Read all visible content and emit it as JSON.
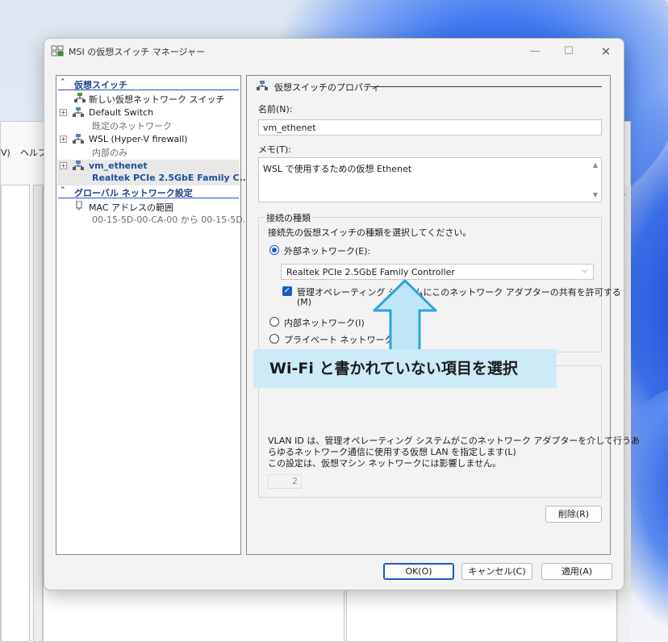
{
  "background_window": {
    "menu_items": [
      "V)",
      "ヘルプ"
    ]
  },
  "dialog": {
    "title": "MSI の仮想スイッチ マネージャー",
    "title_buttons": [
      "minimize",
      "maximize",
      "close"
    ]
  },
  "tree": {
    "section_switches": "仮想スイッチ",
    "new_switch": "新しい仮想ネットワーク スイッチ",
    "switches": [
      {
        "name": "Default Switch",
        "detail": "既定のネットワーク"
      },
      {
        "name": "WSL (Hyper-V firewall)",
        "detail": "内部のみ"
      },
      {
        "name": "vm_ethenet",
        "detail": "Realtek PCIe 2.5GbE Family C..."
      }
    ],
    "section_global": "グローバル ネットワーク設定",
    "mac_range_label": "MAC アドレスの範囲",
    "mac_range_value": "00-15-5D-00-CA-00 から 00-15-5D..."
  },
  "props": {
    "section_title": "仮想スイッチのプロパティ",
    "name_label": "名前(N):",
    "name_value": "vm_ethenet",
    "memo_label": "メモ(T):",
    "memo_value": "WSL で使用するための仮想 Ethenet",
    "conn_group_title": "接続の種類",
    "conn_prompt": "接続先の仮想スイッチの種類を選択してください。",
    "external_label": "外部ネットワーク(E):",
    "adapter_selected": "Realtek PCIe 2.5GbE Family Controller",
    "share_label": "管理オペレーティング システムにこのネットワーク アダプターの共有を許可する",
    "share_label_line2": "(M)",
    "internal_label": "内部ネットワーク(I)",
    "private_label": "プライベート ネットワーク(P)",
    "vlan_desc_1": "VLAN ID は、管理オペレーティング システムがこのネットワーク アダプターを介して行うあ",
    "vlan_desc_2": "らゆるネットワーク通信に使用する仮想 LAN を指定します(L)",
    "vlan_desc_3": "この設定は、仮想マシン ネットワークには影響しません。",
    "vlan_value": "2",
    "delete_button": "削除(R)"
  },
  "buttons": {
    "ok": "OK(O)",
    "cancel": "キャンセル(C)",
    "apply": "適用(A)"
  },
  "annotation": {
    "callout_text": "Wi-Fi と書かれていない項目を選択"
  },
  "colors": {
    "accent": "#1c58c7",
    "callout_bg": "#cdeaf7",
    "arrow_fill": "#bfe6f6",
    "arrow_stroke": "#2ba3dd"
  }
}
